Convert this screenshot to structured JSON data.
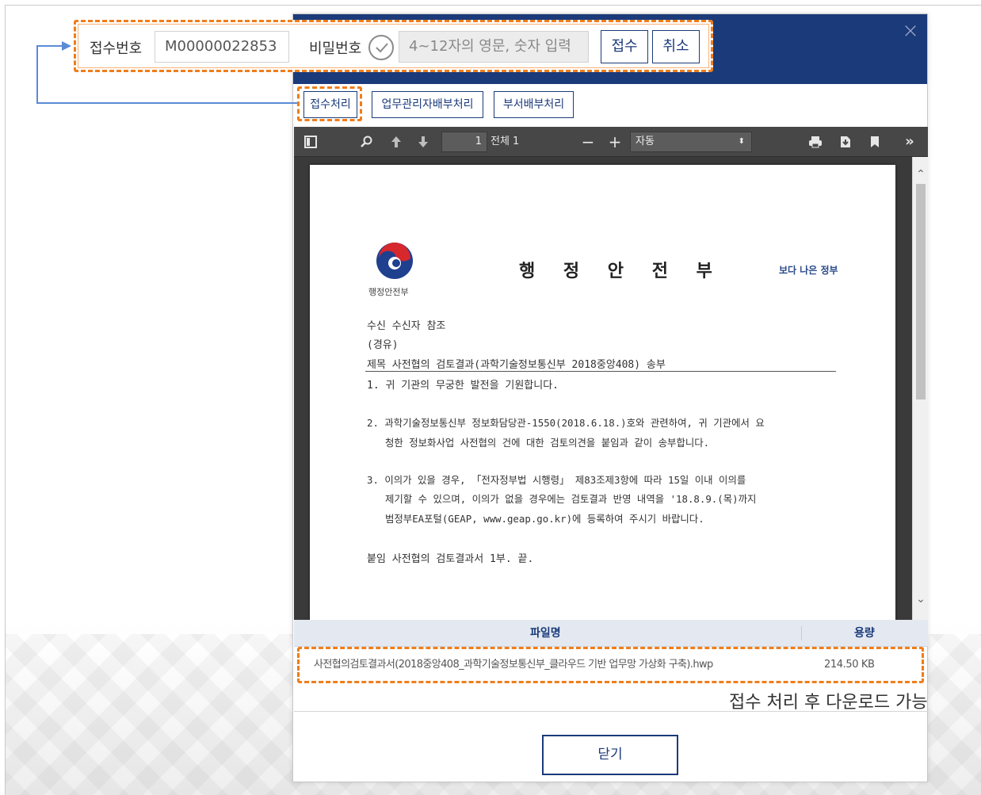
{
  "receipt": {
    "receipt_no_label": "접수번호",
    "receipt_no_value": "M00000022853",
    "password_label": "비밀번호",
    "password_placeholder": "4~12자의 영문, 숫자 입력",
    "accept_button": "접수",
    "cancel_button": "취소"
  },
  "actions": {
    "receipt_process": "접수처리",
    "manager_assign": "업무관리자배부처리",
    "dept_assign": "부서배부처리"
  },
  "pdf_toolbar": {
    "page_current": "1",
    "page_total": "전체 1",
    "zoom_value": "자동"
  },
  "document": {
    "title": "행 정 안 전 부",
    "logo_caption": "행정안전부",
    "slogan": "보다 나은 정부",
    "recipient": "수신  수신자 참조",
    "via": "(경유)",
    "subject": "제목  사전협의 검토결과(과학기술정보통신부 2018중앙408) 송부",
    "p1": "1. 귀 기관의 무궁한 발전을 기원합니다.",
    "p2a": "2. 과학기술정보통신부 정보화담당관-1550(2018.6.18.)호와 관련하여, 귀 기관에서 요",
    "p2b": "청한 정보화사업 사전협의 건에 대한 검토의견을 붙임과 같이 송부합니다.",
    "p3a": "3. 이의가 있을 경우, 「전자정부법 시행령」 제83조제3항에 따라 15일 이내 이의를",
    "p3b": "제기할 수 있으며, 이의가 없을 경우에는 검토결과 반영 내역을 '18.8.9.(목)까지",
    "p3c": "범정부EA포털(GEAP, www.geap.go.kr)에 등록하여 주시기 바랍니다.",
    "attachment": "붙임  사전협의 검토결과서 1부.  끝."
  },
  "files": {
    "col_name": "파일명",
    "col_size": "용량",
    "rows": [
      {
        "name": "사전협의검토결과서(2018중앙408_과학기술정보통신부_클라우드 기반 업무망 가상화 구축).hwp",
        "size": "214.50 KB"
      }
    ]
  },
  "note": "접수 처리 후 다운로드 가능",
  "close_button": "닫기",
  "icons": [
    "close-icon",
    "check-circle-icon",
    "sidebar-toggle-icon",
    "search-icon",
    "arrow-up-icon",
    "arrow-down-icon",
    "zoom-out-icon",
    "zoom-in-icon",
    "print-icon",
    "download-icon",
    "bookmark-icon",
    "more-icon",
    "scroll-up-icon",
    "scroll-down-icon"
  ],
  "colors": {
    "header": "#1b3a7a",
    "highlight": "#f07d1a",
    "pdf_toolbar": "#474747",
    "pdf_bg": "#3a3a3a",
    "table_head": "#e4e9f1"
  }
}
